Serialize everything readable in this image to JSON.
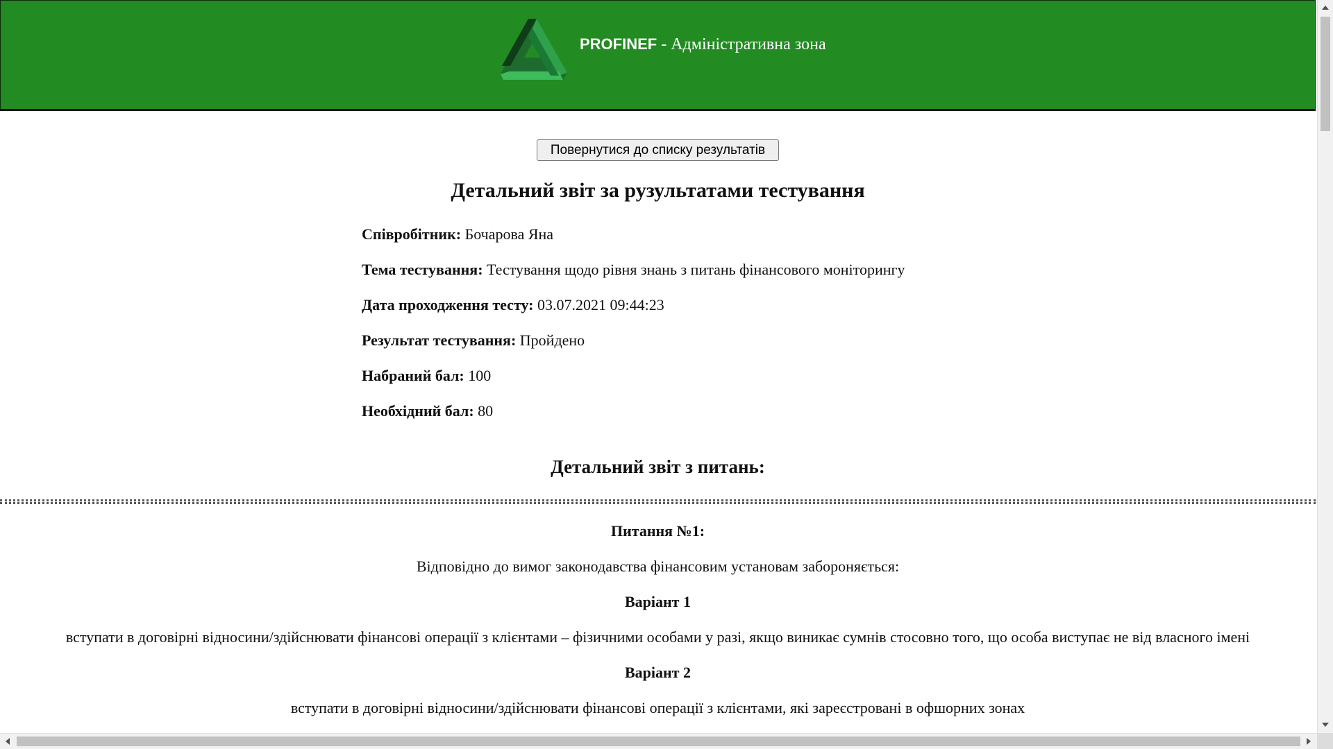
{
  "header": {
    "brand": "PROFINEF",
    "subtitle": " - Адміністративна зона",
    "logo_icon": "triangle-logo-icon",
    "background_color": "#228b22"
  },
  "toolbar": {
    "back_label": "Повернутися до списку результатів"
  },
  "report": {
    "title": "Детальний звіт за рузультатами тестування",
    "fields": [
      {
        "label": "Співробітник:",
        "value": " Бочарова Яна"
      },
      {
        "label": "Тема тестування:",
        "value": " Тестування щодо рівня знань з питань фінансового моніторингу"
      },
      {
        "label": "Дата проходження тесту:",
        "value": " 03.07.2021 09:44:23"
      },
      {
        "label": "Результат тестування:",
        "value": " Пройдено"
      },
      {
        "label": "Набраний бал:",
        "value": " 100"
      },
      {
        "label": "Необхідний бал:",
        "value": " 80"
      }
    ]
  },
  "questions_section": {
    "title": "Детальний звіт з питань:",
    "questions": [
      {
        "number_label": "Питання №1:",
        "text": "Відповідно до вимог законодавства фінансовим установам забороняється:",
        "options": [
          {
            "label": "Варіант 1",
            "text": "вступати в договірні відносини/здійснювати фінансові операції з клієнтами – фізичними особами у разі, якщо виникає сумнів стосовно того, що особа виступає не від власного імені"
          },
          {
            "label": "Варіант 2",
            "text": "вступати в договірні відносини/здійснювати фінансові операції з клієнтами, які зареєстровані в офшорних зонах"
          }
        ]
      }
    ]
  }
}
